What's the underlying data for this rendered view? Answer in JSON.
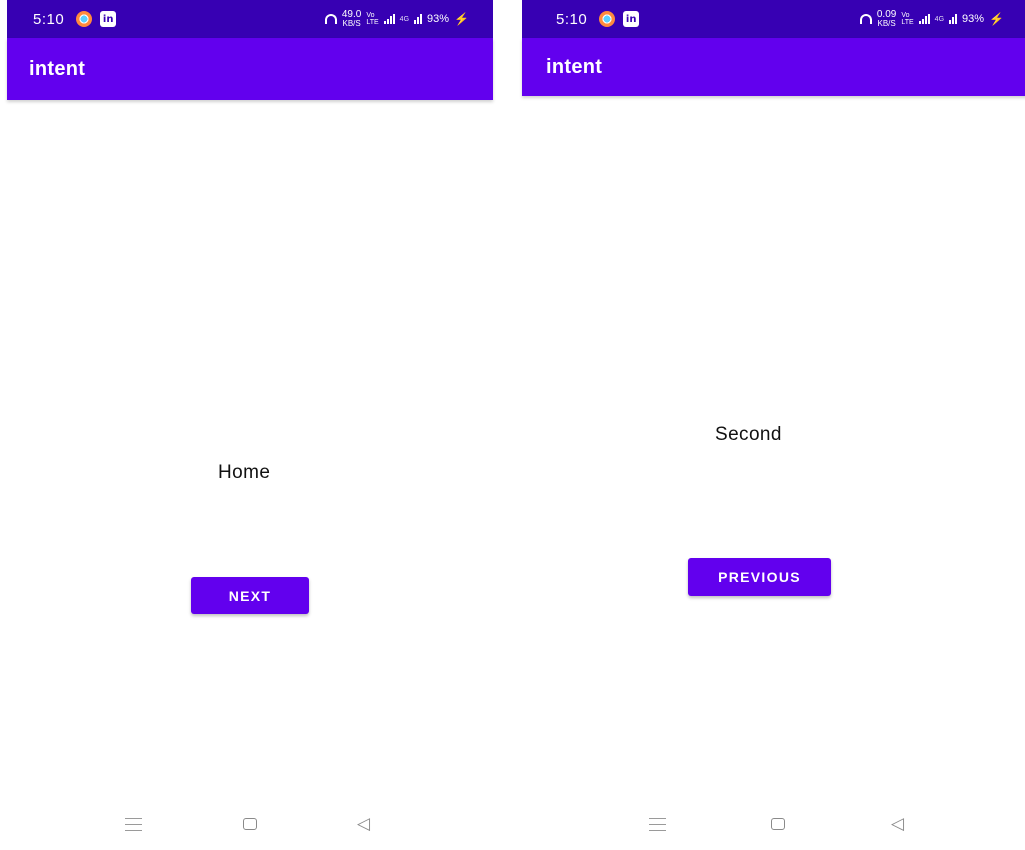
{
  "screens": [
    {
      "status_bar": {
        "time": "5:10",
        "speed_value": "49.0",
        "speed_unit": "KB/S",
        "volte_top": "Vo",
        "volte_bottom": "LTE",
        "network": "4G",
        "battery": "93%",
        "icons": [
          "notification-app-icon",
          "linkedin-icon",
          "headset-icon",
          "signal-icon",
          "charging-icon"
        ]
      },
      "app_bar": {
        "title": "intent"
      },
      "label": "Home",
      "button_label": "NEXT",
      "nav_bar": {
        "icons": [
          "menu-icon",
          "home-icon",
          "back-icon"
        ]
      }
    },
    {
      "status_bar": {
        "time": "5:10",
        "speed_value": "0.09",
        "speed_unit": "KB/S",
        "volte_top": "Vo",
        "volte_bottom": "LTE",
        "network": "4G",
        "battery": "93%",
        "icons": [
          "notification-app-icon",
          "linkedin-icon",
          "headset-icon",
          "signal-icon",
          "charging-icon"
        ]
      },
      "app_bar": {
        "title": "intent"
      },
      "label": "Second",
      "button_label": "PREVIOUS",
      "nav_bar": {
        "icons": [
          "menu-icon",
          "home-icon",
          "back-icon"
        ]
      }
    }
  ],
  "colors": {
    "status_bar": "#3700b3",
    "primary": "#6200ee",
    "background": "#ffffff",
    "text": "#111111"
  }
}
